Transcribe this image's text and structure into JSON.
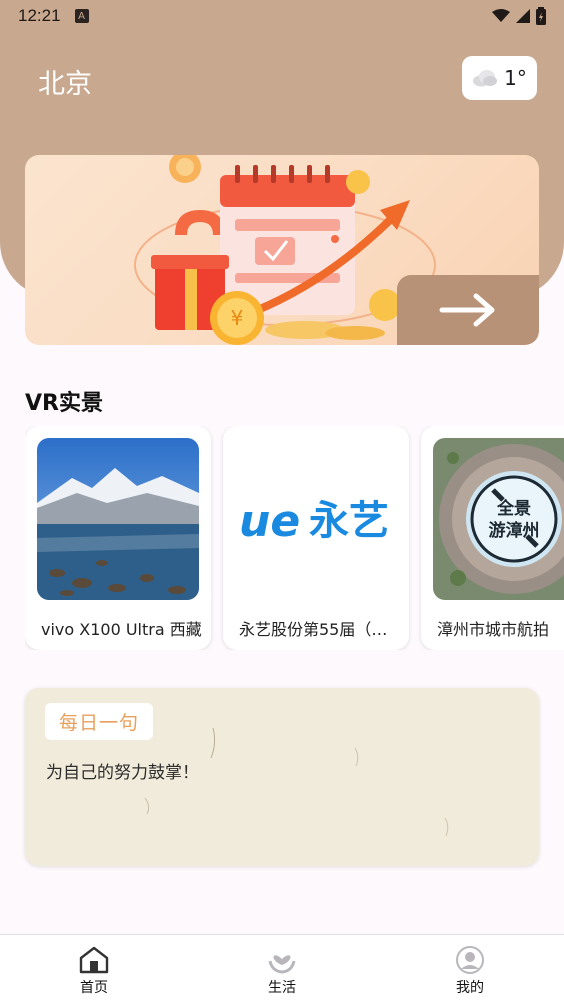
{
  "status_bar": {
    "time": "12:21"
  },
  "header": {
    "city": "北京",
    "weather": {
      "temperature": "1°",
      "icon": "cloud-icon"
    }
  },
  "banner": {
    "icon": "arrow-right-icon"
  },
  "vr_section": {
    "title": "VR实景",
    "items": [
      {
        "caption": "vivo X100 Ultra 西藏",
        "thumb": "mountain-lake-photo"
      },
      {
        "caption": "永艺股份第55届（…",
        "thumb": "ue-yongyi-logo",
        "logo_text": "永艺"
      },
      {
        "caption": "漳州市城市航拍",
        "thumb": "aerial-panorama",
        "overlay_line1": "全景",
        "overlay_line2": "游漳州"
      }
    ]
  },
  "daily_quote": {
    "tag": "每日一句",
    "text": "为自己的努力鼓掌！"
  },
  "bottom_nav": {
    "items": [
      {
        "label": "首页",
        "icon": "home-icon"
      },
      {
        "label": "生活",
        "icon": "heart-hand-icon"
      },
      {
        "label": "我的",
        "icon": "profile-icon"
      }
    ]
  },
  "colors": {
    "header": "#c8a98f",
    "accent_tag": "#e8a05c",
    "brand_blue": "#1a8ae0"
  }
}
